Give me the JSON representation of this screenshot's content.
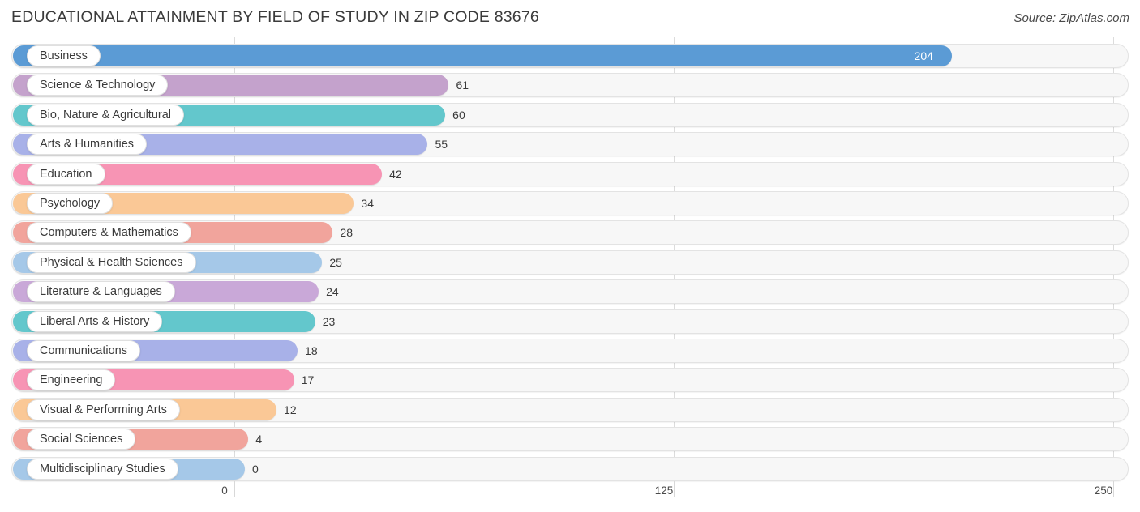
{
  "header": {
    "title": "EDUCATIONAL ATTAINMENT BY FIELD OF STUDY IN ZIP CODE 83676",
    "source": "Source: ZipAtlas.com"
  },
  "axis": {
    "ticks": [
      "0",
      "125",
      "250"
    ],
    "min": 0,
    "max": 250
  },
  "chart_data": {
    "type": "bar",
    "orientation": "horizontal",
    "title": "EDUCATIONAL ATTAINMENT BY FIELD OF STUDY IN ZIP CODE 83676",
    "subtitle": "Source: ZipAtlas.com",
    "xlabel": "",
    "ylabel": "",
    "xlim": [
      0,
      250
    ],
    "xticks": [
      0,
      125,
      250
    ],
    "grid": true,
    "legend": false,
    "categories": [
      "Business",
      "Science & Technology",
      "Bio, Nature & Agricultural",
      "Arts & Humanities",
      "Education",
      "Psychology",
      "Computers & Mathematics",
      "Physical & Health Sciences",
      "Literature & Languages",
      "Liberal Arts & History",
      "Communications",
      "Engineering",
      "Visual & Performing Arts",
      "Social Sciences",
      "Multidisciplinary Studies"
    ],
    "values": [
      204,
      61,
      60,
      55,
      42,
      34,
      28,
      25,
      24,
      23,
      18,
      17,
      12,
      4,
      0
    ],
    "colors": [
      "#5b9bd5",
      "#c4a2cc",
      "#63c7cc",
      "#a8b1e8",
      "#f794b4",
      "#fac896",
      "#f1a49c",
      "#a5c8e8",
      "#c9a8d8",
      "#63c7cc",
      "#a8b1e8",
      "#f794b4",
      "#fac896",
      "#f1a49c",
      "#a5c8e8"
    ]
  }
}
